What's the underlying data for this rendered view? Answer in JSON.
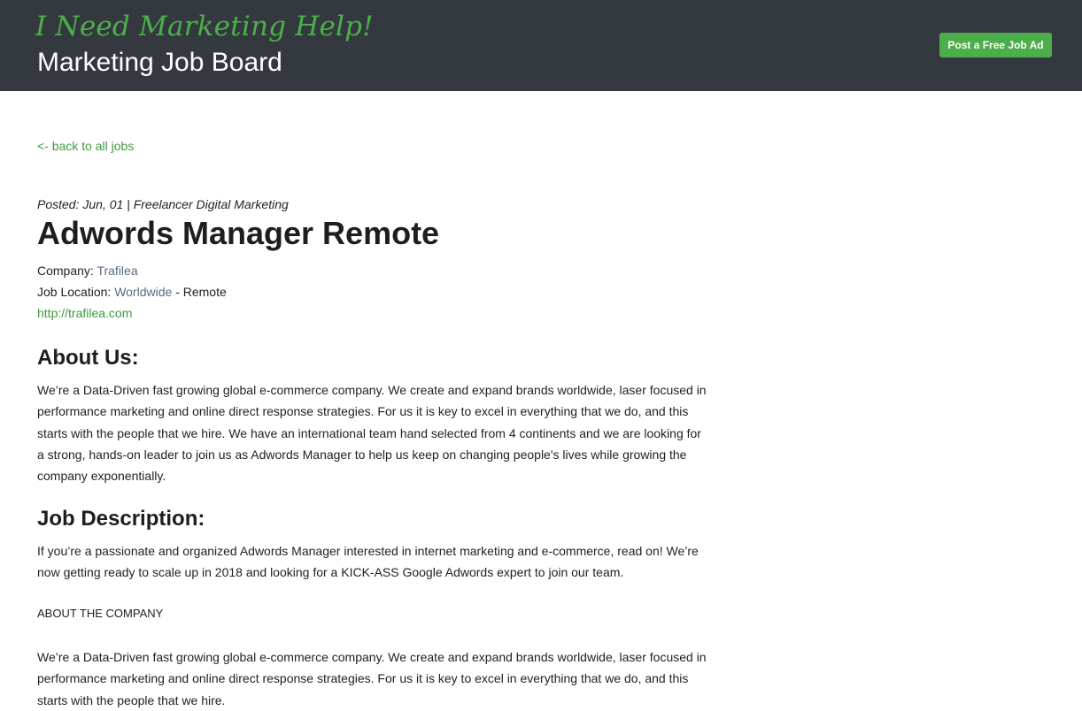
{
  "header": {
    "tagline": "I Need Marketing Help!",
    "site_title": "Marketing Job Board",
    "post_button_label": "Post a Free Job Ad"
  },
  "nav": {
    "back_link": "<- back to all jobs"
  },
  "job": {
    "posted": "Posted: Jun, 01 | Freelancer Digital Marketing",
    "title": "Adwords Manager Remote",
    "company_label": "Company:",
    "company_name": "Trafilea",
    "location_label": "Job Location:",
    "location_name": "Worldwide",
    "location_suffix": "- Remote",
    "website": "http://trafilea.com"
  },
  "about": {
    "heading": "About Us:",
    "body": "We’re a Data-Driven fast growing global e-commerce company. We create and expand brands worldwide, laser focused in performance marketing and online direct response strategies. For us it is key to excel in everything that we do, and this starts with the people that we hire. We have an international team hand selected from 4 continents and we are looking for a strong, hands-on leader to join us as Adwords Manager to help us keep on changing people's lives while growing the company exponentially."
  },
  "description": {
    "heading": "Job Description:",
    "intro": "If you’re a passionate and organized Adwords Manager interested in internet marketing and e-commerce, read on! We’re now getting ready to scale up in 2018 and looking for a KICK-ASS Google Adwords expert to join our team.",
    "about_company_label": "ABOUT THE COMPANY",
    "about_company_body": "We’re a Data-Driven fast growing global e-commerce company. We create and expand brands worldwide, laser focused in performance marketing and online direct response strategies. For us it is key to excel in everything that we do, and this starts with the people that we hire."
  },
  "colors": {
    "header_bg": "#343940",
    "accent_green": "#4cae4a",
    "link_slate": "#5a6d80"
  }
}
